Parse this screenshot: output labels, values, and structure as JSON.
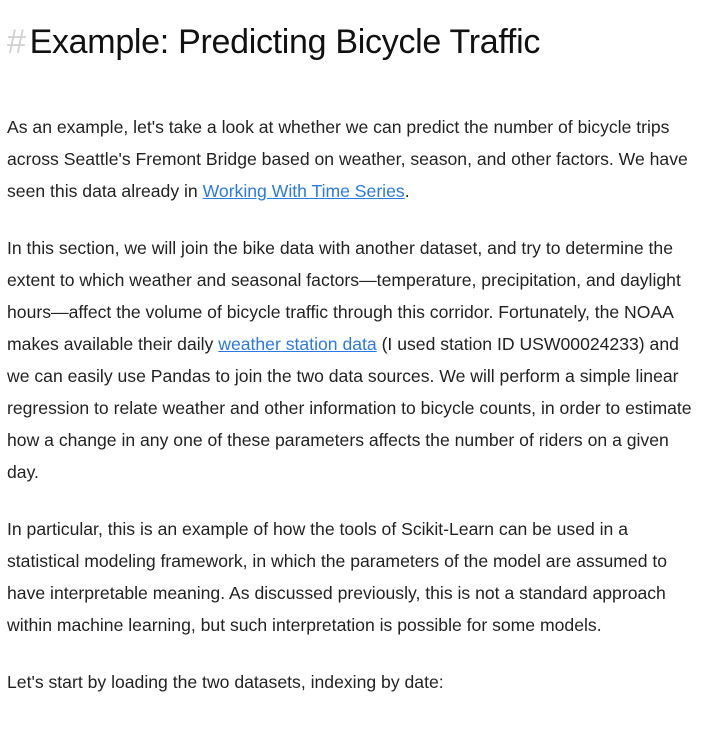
{
  "heading": {
    "hash": "#",
    "title": "Example: Predicting Bicycle Traffic"
  },
  "para1": {
    "before": "As an example, let's take a look at whether we can predict the number of bicycle trips across Seattle's Fremont Bridge based on weather, season, and other factors. We have seen this data already in ",
    "link": "Working With Time Series",
    "after": "."
  },
  "para2": {
    "before": "In this section, we will join the bike data with another dataset, and try to determine the extent to which weather and seasonal factors—temperature, precipitation, and daylight hours—affect the volume of bicycle traffic through this corridor. Fortunately, the NOAA makes available their daily ",
    "link": "weather station data",
    "after": " (I used station ID USW00024233) and we can easily use Pandas to join the two data sources. We will perform a simple linear regression to relate weather and other information to bicycle counts, in order to estimate how a change in any one of these parameters affects the number of riders on a given day."
  },
  "para3": {
    "text": "In particular, this is an example of how the tools of Scikit-Learn can be used in a statistical modeling framework, in which the parameters of the model are assumed to have interpretable meaning. As discussed previously, this is not a standard approach within machine learning, but such interpretation is possible for some models."
  },
  "para4": {
    "text": "Let's start by loading the two datasets, indexing by date:"
  },
  "colors": {
    "link": "#2a7ae2",
    "text": "#222222",
    "hash": "#d0d0d0"
  }
}
